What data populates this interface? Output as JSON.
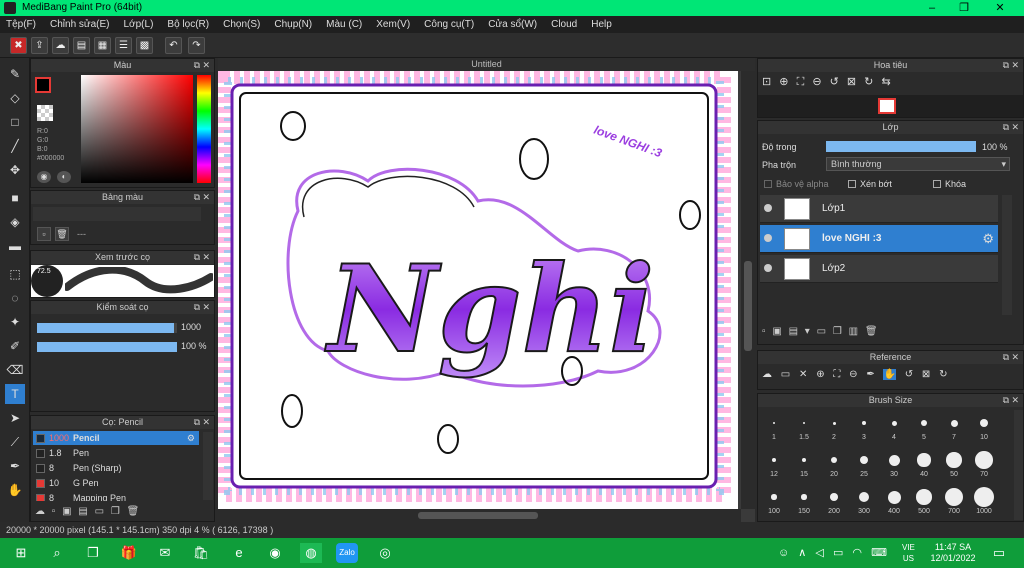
{
  "window": {
    "title": "MediBang Paint Pro (64bit)"
  },
  "menu": [
    "Tệp(F)",
    "Chỉnh sửa(E)",
    "Lớp(L)",
    "Bộ lọc(R)",
    "Chọn(S)",
    "Chụp(N)",
    "Màu (C)",
    "Xem(V)",
    "Công cụ(T)",
    "Cửa sổ(W)",
    "Cloud",
    "Help"
  ],
  "color_panel": {
    "title": "Màu",
    "r": "R:0",
    "g": "G:0",
    "b": "B:0",
    "hex": "#000000"
  },
  "palette_panel": {
    "title": "Bảng màu",
    "dash": "---"
  },
  "preview_panel": {
    "title": "Xem trước cọ",
    "size": "72.5"
  },
  "brush_control": {
    "title": "Kiểm soát cọ",
    "size_value": "1000",
    "opacity_value": "100 %",
    "size_fill": 0.98,
    "opacity_fill": 1.0
  },
  "brush_panel": {
    "title": "Cọ: Pencil",
    "rows": [
      {
        "size": "1000",
        "name": "Pencil",
        "color": "#1a2a3a"
      },
      {
        "size": "1.8",
        "name": "Pen",
        "color": "#222"
      },
      {
        "size": "8",
        "name": "Pen (Sharp)",
        "color": "#222"
      },
      {
        "size": "10",
        "name": "G Pen",
        "color": "#e53935"
      },
      {
        "size": "8",
        "name": "Mapping Pen",
        "color": "#e53935"
      }
    ]
  },
  "canvas": {
    "doc_title": "Untitled",
    "art_text": "Nghi",
    "side_text": "love NGHI :3"
  },
  "navigator": {
    "title": "Hoa tiêu"
  },
  "layer_panel": {
    "title": "Lớp",
    "opacity_label": "Độ trong",
    "opacity_value": "100 %",
    "opacity_fill": 1.0,
    "blend_label": "Pha trộn",
    "blend_value": "Bình thường",
    "protect_alpha": "Bảo vệ alpha",
    "clipping": "Xén bớt",
    "lock": "Khóa",
    "layers": [
      {
        "name": "Lớp1",
        "selected": false
      },
      {
        "name": "love NGHI :3",
        "selected": true
      },
      {
        "name": "Lớp2",
        "selected": false
      }
    ]
  },
  "reference_panel": {
    "title": "Reference"
  },
  "brush_size_panel": {
    "title": "Brush Size",
    "sizes": [
      "1",
      "1.5",
      "2",
      "3",
      "4",
      "5",
      "7",
      "10",
      "12",
      "15",
      "20",
      "25",
      "30",
      "40",
      "50",
      "70",
      "100",
      "150",
      "200",
      "300",
      "400",
      "500",
      "700",
      "1000"
    ]
  },
  "status": {
    "text": "20000 * 20000 pixel  (145.1 * 145.1cm)  350 dpi  4 %  ( 6126, 17398 )"
  },
  "taskbar": {
    "lang1": "VIE",
    "lang2": "US",
    "time": "11:47 SA",
    "date": "12/01/2022",
    "zalo": "Zalo"
  },
  "colors": {
    "accent": "#2f7fd0",
    "title_green": "#00e676",
    "taskbar_green": "#0f9d3a",
    "art_purple": "#9b3ee0"
  }
}
